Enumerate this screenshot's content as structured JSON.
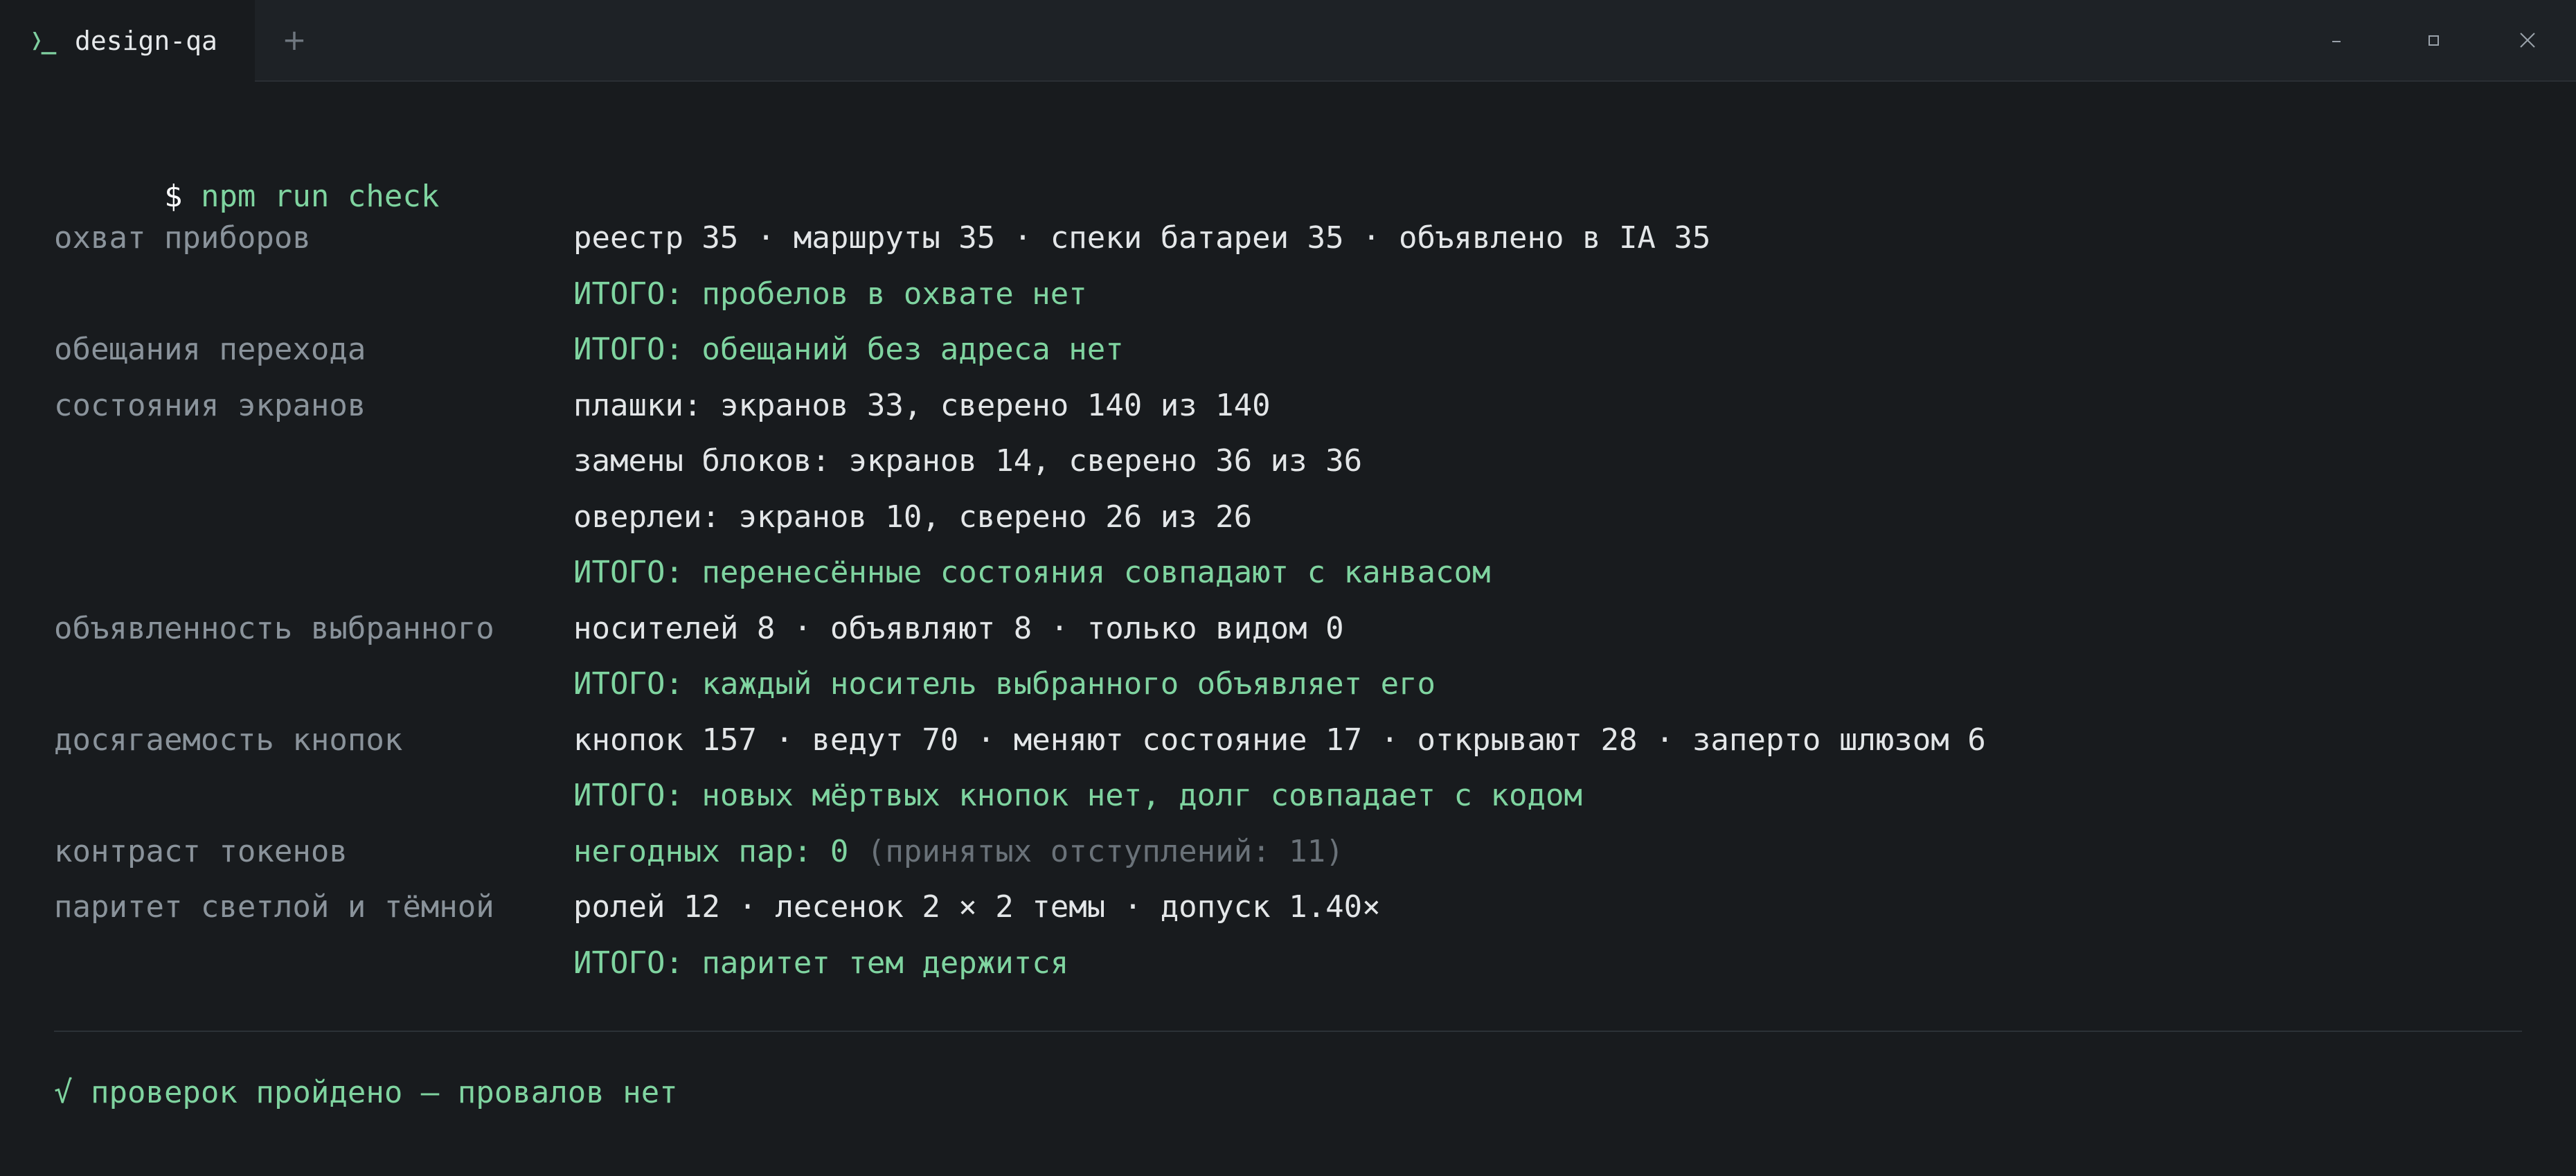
{
  "window": {
    "tab_icon": "❭_",
    "tab_title": "design-qa",
    "new_tab_label": "+",
    "controls": [
      "minimize-icon",
      "maximize-icon",
      "close-icon"
    ]
  },
  "terminal": {
    "prompt_symbol": "$",
    "command": "npm run check",
    "checks": [
      {
        "label": "охват приборов",
        "lines": [
          {
            "text": "реестр 35 · маршруты 35 · спеки батареи 35 · объявлено в IA 35",
            "style": "normal"
          },
          {
            "text": "ИТОГО: пробелов в охвате нет",
            "style": "ok"
          }
        ]
      },
      {
        "label": "обещания перехода",
        "lines": [
          {
            "text": "ИТОГО: обещаний без адреса нет",
            "style": "ok"
          }
        ]
      },
      {
        "label": "состояния экранов",
        "lines": [
          {
            "text": "плашки: экранов 33, сверено 140 из 140",
            "style": "normal"
          },
          {
            "text": "замены блоков: экранов 14, сверено 36 из 36",
            "style": "normal"
          },
          {
            "text": "оверлеи: экранов 10, сверено 26 из 26",
            "style": "normal"
          },
          {
            "text": "ИТОГО: перенесённые состояния совпадают с канвасом",
            "style": "ok"
          }
        ]
      },
      {
        "label": "объявленность выбранного",
        "lines": [
          {
            "text": "носителей 8 · объявляют 8 · только видом 0",
            "style": "normal"
          },
          {
            "text": "ИТОГО: каждый носитель выбранного объявляет его",
            "style": "ok"
          }
        ]
      },
      {
        "label": "досягаемость кнопок",
        "lines": [
          {
            "text": "кнопок 157 · ведут 70 · меняют состояние 17 · открывают 28 · заперто шлюзом 6",
            "style": "normal"
          },
          {
            "text": "ИТОГО: новых мёртвых кнопок нет, долг совпадает с кодом",
            "style": "ok"
          }
        ]
      },
      {
        "label": "контраст токенов",
        "lines": [
          {
            "text": "негодных пар: 0",
            "style": "ok",
            "suffix": " (принятых отступлений: 11)"
          }
        ]
      },
      {
        "label": "паритет светлой и тёмной",
        "lines": [
          {
            "text": "ролей 12 · лесенок 2 × 2 темы · допуск 1.40×",
            "style": "normal"
          },
          {
            "text": "ИТОГО: паритет тем держится",
            "style": "ok"
          }
        ]
      }
    ],
    "summary": "√ проверок пройдено — провалов нет",
    "colors": {
      "ok": "#7fd4a0",
      "label": "#8a939b",
      "value": "#e3e6e8",
      "muted": "#6a7279",
      "background": "#181b1e"
    }
  }
}
